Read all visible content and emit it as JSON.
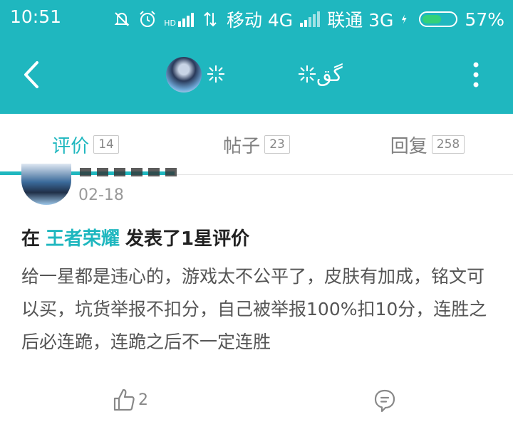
{
  "status_bar": {
    "time": "10:51",
    "network_badge": "HD",
    "carrier1": "移动 4G",
    "carrier2": "联通 3G",
    "battery": "57%",
    "battery_level": 0.57
  },
  "header": {
    "title": "گق",
    "back_icon": "back-arrow-icon",
    "more_icon": "more-vertical-icon"
  },
  "tabs": [
    {
      "label": "评价",
      "count": "14",
      "active": true
    },
    {
      "label": "帖子",
      "count": "23",
      "active": false
    },
    {
      "label": "回复",
      "count": "258",
      "active": false
    }
  ],
  "review": {
    "date": "02-18",
    "headline_prefix": "在",
    "game": "王者荣耀",
    "headline_suffix": "发表了1星评价",
    "body": "给一星都是违心的，游戏太不公平了，皮肤有加成，铭文可以买，坑货举报不扣分，自己被举报100%扣10分，连胜之后必连跪，连跪之后不一定连胜",
    "likes": "2"
  },
  "colors": {
    "accent": "#1fb7bf",
    "battery_green": "#33d17a"
  }
}
